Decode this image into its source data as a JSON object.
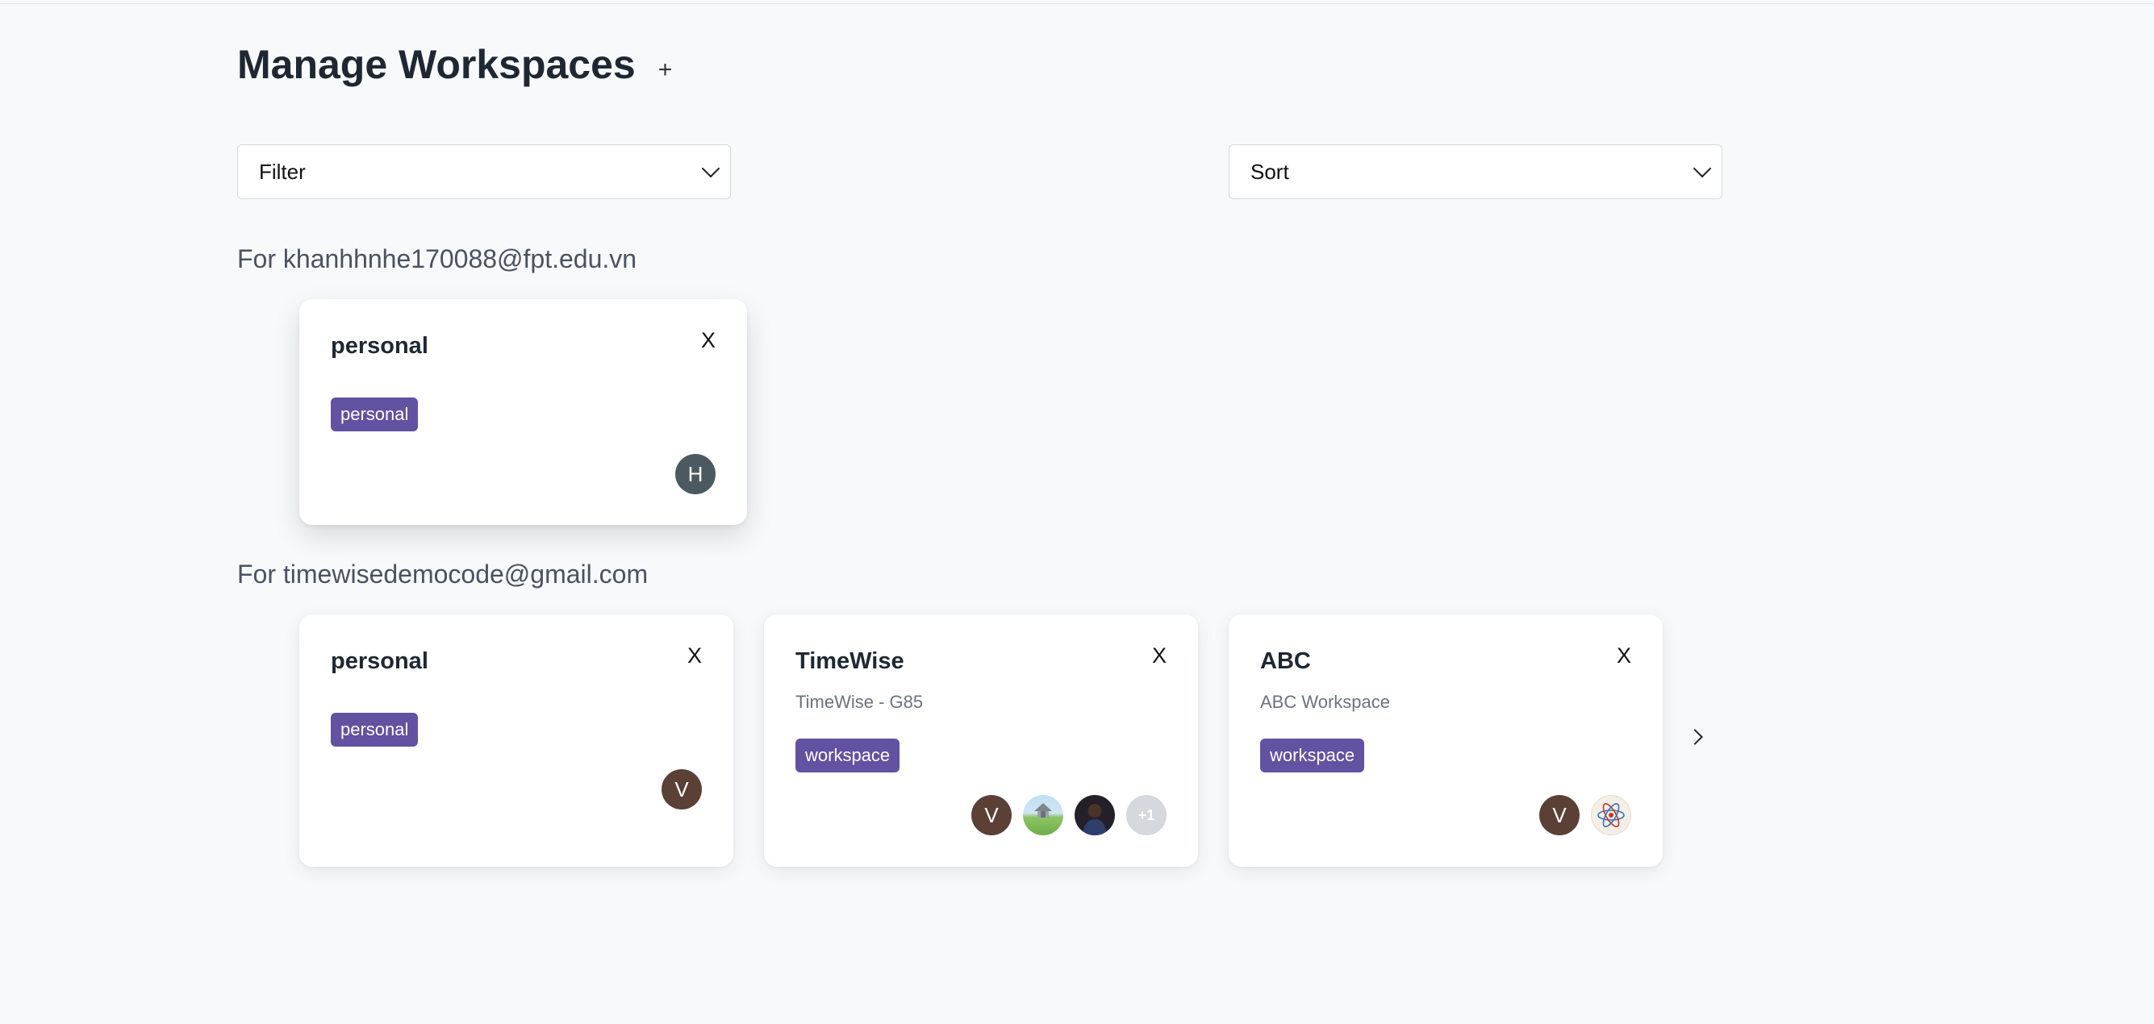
{
  "header": {
    "title": "Manage Workspaces",
    "add_label": "+"
  },
  "filter": {
    "label": "Filter"
  },
  "sort": {
    "label": "Sort"
  },
  "groups": [
    {
      "label": "For khanhhnhe170088@fpt.edu.vn",
      "cards": [
        {
          "title": "personal",
          "description": "",
          "tag": "personal",
          "close": "X",
          "avatars": [
            {
              "initial": "H"
            }
          ]
        }
      ]
    },
    {
      "label": "For timewisedemocode@gmail.com",
      "cards": [
        {
          "title": "personal",
          "description": "",
          "tag": "personal",
          "close": "X",
          "avatars": [
            {
              "initial": "V"
            }
          ]
        },
        {
          "title": "TimeWise",
          "description": "TimeWise - G85",
          "tag": "workspace",
          "close": "X",
          "avatars": [
            {
              "initial": "V"
            },
            {
              "image": "landscape-photo"
            },
            {
              "image": "person-photo"
            },
            {
              "more": "+1"
            }
          ]
        },
        {
          "title": "ABC",
          "description": "ABC Workspace",
          "tag": "workspace",
          "close": "X",
          "avatars": [
            {
              "initial": "V"
            },
            {
              "image": "atom-icon"
            }
          ]
        }
      ]
    }
  ],
  "colors": {
    "tag_bg": "#6351a2",
    "background": "#f8f9fb"
  }
}
